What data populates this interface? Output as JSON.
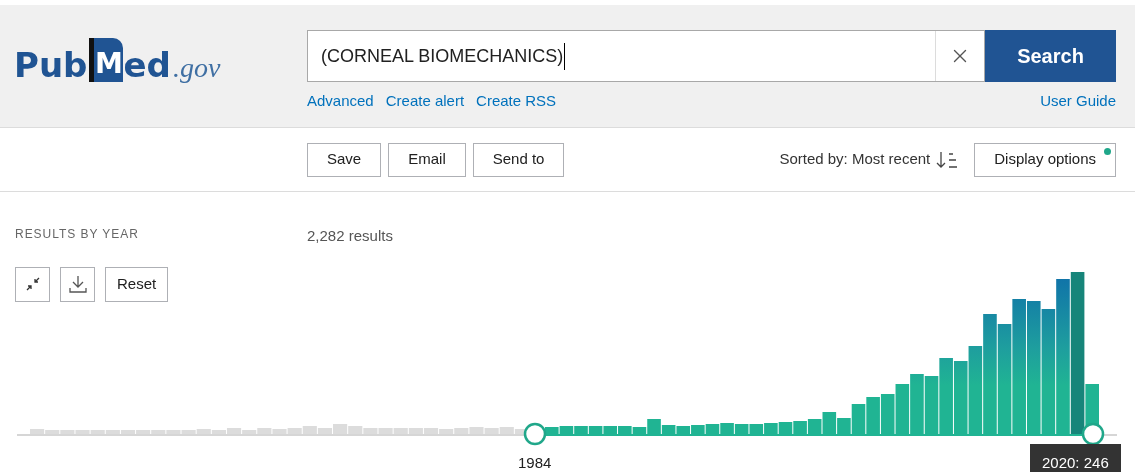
{
  "logo": {
    "prefix": "Pub",
    "mark": "M",
    "rest": "ed",
    "domain": ".gov"
  },
  "search": {
    "value": "(CORNEAL BIOMECHANICS)",
    "button": "Search"
  },
  "search_links": [
    "Advanced",
    "Create alert",
    "Create RSS"
  ],
  "user_guide": "User Guide",
  "actions": [
    "Save",
    "Email",
    "Send to"
  ],
  "sort": {
    "label": "Sorted by: Most recent"
  },
  "display_options": {
    "label": "Display options",
    "badge": true
  },
  "results_by_year": {
    "title": "RESULTS BY YEAR",
    "count": "2,282 results",
    "reset": "Reset",
    "start_label": "1984",
    "end_tooltip": "2020: 246"
  }
}
